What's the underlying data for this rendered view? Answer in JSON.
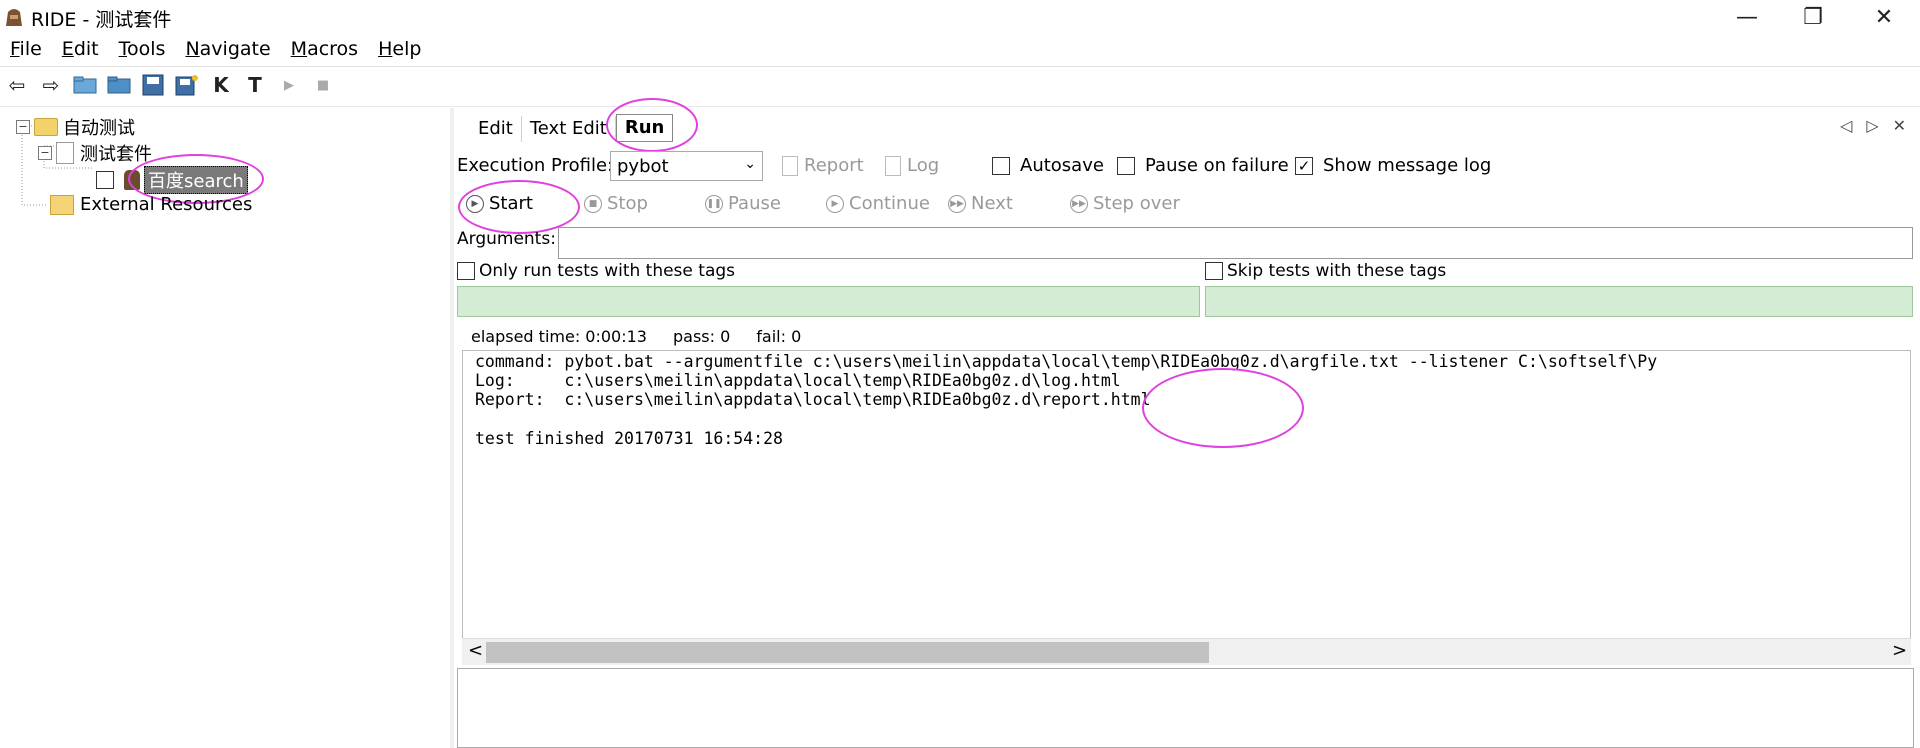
{
  "window": {
    "title": "RIDE - 测试套件",
    "minimize": "—",
    "restore": "❐",
    "close": "✕"
  },
  "menu": [
    {
      "underline": "F",
      "rest": "ile"
    },
    {
      "underline": "E",
      "rest": "dit"
    },
    {
      "underline": "T",
      "rest": "ools"
    },
    {
      "underline": "N",
      "rest": "avigate"
    },
    {
      "underline": "M",
      "rest": "acros"
    },
    {
      "underline": "H",
      "rest": "elp"
    }
  ],
  "toolbar": {
    "back": "⇦",
    "forward": "⇨",
    "open_suite": "📂",
    "open_dir": "📁",
    "save": "💾",
    "save_all": "💾",
    "keyword_search": "K",
    "test_search": "T",
    "run": "▶",
    "stop": "■"
  },
  "tree": {
    "root": "自动测试",
    "suite": "测试套件",
    "test": "百度search",
    "external": "External Resources"
  },
  "tabs": [
    "Edit",
    "Text Edit",
    "Run"
  ],
  "tab_nav": {
    "prev": "◁",
    "next": "▷",
    "close": "✕"
  },
  "run": {
    "profile_label": "Execution Profile:",
    "profile_value": "pybot",
    "report": "Report",
    "log": "Log",
    "autosave": "Autosave",
    "pause_on_failure": "Pause on failure",
    "show_message_log": "Show message log",
    "start": "Start",
    "stop": "Stop",
    "pause": "Pause",
    "continue": "Continue",
    "next": "Next",
    "step_over": "Step over",
    "arguments_label": "Arguments:",
    "only_run_tags": "Only run tests with these tags",
    "skip_tags": "Skip tests with these tags",
    "elapsed": "elapsed time: 0:00:13",
    "pass": "pass: 0",
    "fail": "fail: 0"
  },
  "output": [
    "command: pybot.bat --argumentfile c:\\users\\meilin\\appdata\\local\\temp\\RIDEa0bg0z.d\\argfile.txt --listener C:\\softself\\Py",
    "Log:     c:\\users\\meilin\\appdata\\local\\temp\\RIDEa0bg0z.d\\log.html",
    "Report:  c:\\users\\meilin\\appdata\\local\\temp\\RIDEa0bg0z.d\\report.html",
    "",
    "test finished 20170731 16:54:28"
  ],
  "scroll": {
    "left": "<",
    "right": ">"
  },
  "annotation_color": "#e040e0"
}
